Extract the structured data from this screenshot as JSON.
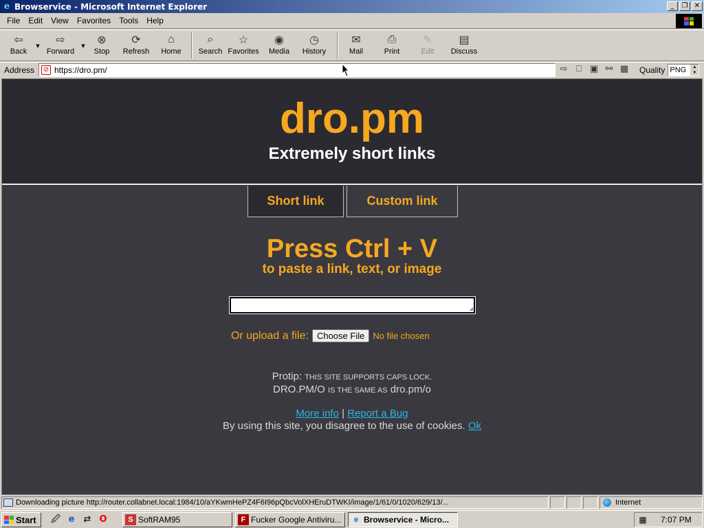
{
  "window": {
    "title": "Browservice - Microsoft Internet Explorer",
    "controls": {
      "minimize": "_",
      "restore": "❐",
      "close": "✕"
    }
  },
  "menu": [
    "File",
    "Edit",
    "View",
    "Favorites",
    "Tools",
    "Help"
  ],
  "toolbar": {
    "back": "Back",
    "forward": "Forward",
    "stop": "Stop",
    "refresh": "Refresh",
    "home": "Home",
    "search": "Search",
    "favorites": "Favorites",
    "media": "Media",
    "history": "History",
    "mail": "Mail",
    "print": "Print",
    "edit": "Edit",
    "discuss": "Discuss"
  },
  "address": {
    "label": "Address",
    "url": "https://dro.pm/",
    "quality_label": "Quality",
    "quality_value": "PNG"
  },
  "page": {
    "brand": "dro.pm",
    "tagline": "Extremely short links",
    "tabs": {
      "short": "Short link",
      "custom": "Custom link"
    },
    "press": "Press Ctrl + V",
    "press_sub": "to paste a link, text, or image",
    "upload_label": "Or upload a file:",
    "choose_file": "Choose File",
    "no_file": "No file chosen",
    "protip_label": "Protip:",
    "protip_text": "this site supports caps lock.",
    "protip_example_upper": "DRO.PM/O",
    "protip_middle": "is the same as",
    "protip_example_lower": "dro.pm/o",
    "more_info": "More info",
    "separator": "|",
    "report_bug": "Report a Bug",
    "cookies_text": "By using this site, you disagree to the use of cookies.",
    "ok": "Ok"
  },
  "status": {
    "text": "Downloading picture http://router.collabnet.local:1984/10/aYKwmHePZ4F6I96pQbcVolXHEruDTWKI/image/1/61/0/1020/629/13/...",
    "zone": "Internet"
  },
  "taskbar": {
    "start": "Start",
    "tasks": [
      "SoftRAM95",
      "Fucker Google Antiviru...",
      "Browservice - Micro..."
    ],
    "clock": "7:07 PM"
  },
  "colors": {
    "accent": "#f6a821",
    "header_bg": "#2b2a30",
    "page_bg": "#3a393f",
    "link": "#29b6e8"
  }
}
